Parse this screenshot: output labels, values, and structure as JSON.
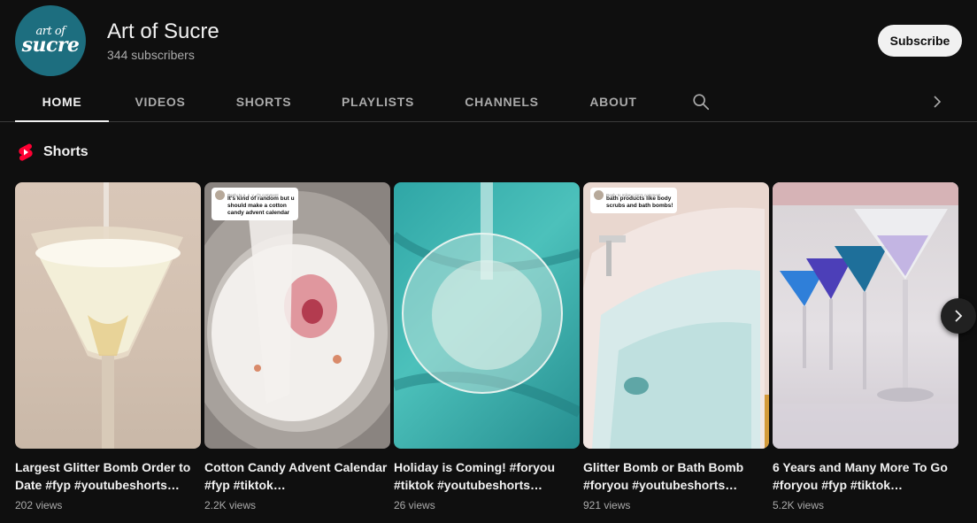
{
  "channel": {
    "avatar_text_top": "art of",
    "avatar_text_bottom": "sucre",
    "name": "Art of Sucre",
    "subscribers": "344 subscribers",
    "subscribe_label": "Subscribe"
  },
  "tabs": [
    {
      "label": "HOME",
      "active": true
    },
    {
      "label": "VIDEOS"
    },
    {
      "label": "SHORTS"
    },
    {
      "label": "PLAYLISTS"
    },
    {
      "label": "CHANNELS"
    },
    {
      "label": "ABOUT"
    }
  ],
  "icons": {
    "search": "search-icon",
    "tabs_next": "chevron-right-icon",
    "shorts": "shorts-logo-icon",
    "shelf_next": "chevron-right-icon"
  },
  "colors": {
    "background": "#0f0f0f",
    "shorts_red": "#ff0033",
    "avatar_teal": "#1d6e7f"
  },
  "shelf": {
    "title": "Shorts",
    "items": [
      {
        "title": "Largest Glitter Bomb Order to Date #fyp #youtubeshorts…",
        "views": "202 views"
      },
      {
        "title": "Cotton Candy Advent Calendar #fyp #tiktok…",
        "views": "2.2K views",
        "reply_header": "Reply to a_s_y_d's comment",
        "reply_text": "It's kind of random but u should make a cotton candy advent calendar"
      },
      {
        "title": "Holiday is Coming! #foryou #tiktok #youtubeshorts…",
        "views": "26 views"
      },
      {
        "title": "Glitter Bomb or Bath Bomb #foryou #youtubeshorts…",
        "views": "921 views",
        "reply_header": "Reply to mikey.cjon's comment",
        "reply_text": "bath products like body scrubs and bath bombs!"
      },
      {
        "title": "6 Years and Many More To Go #foryou #fyp #tiktok…",
        "views": "5.2K views"
      }
    ]
  }
}
